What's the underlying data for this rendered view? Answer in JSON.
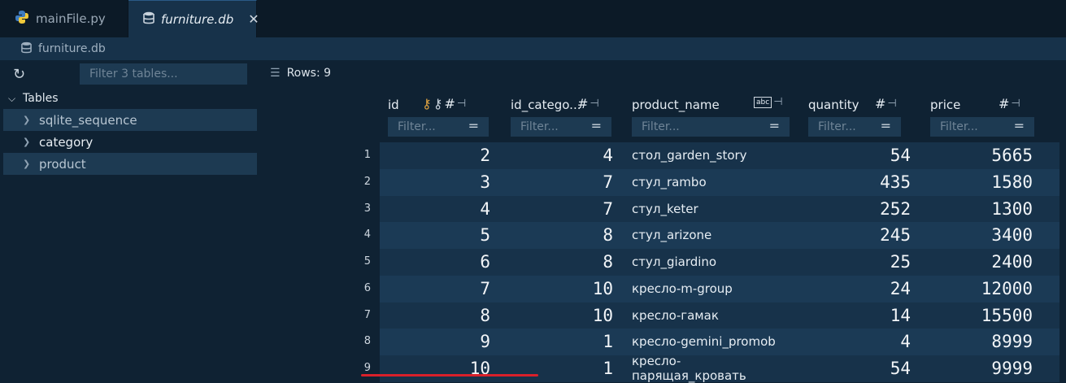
{
  "tabs": [
    {
      "label": "mainFile.py",
      "icon": "python-icon",
      "active": false
    },
    {
      "label": "furniture.db",
      "icon": "database-icon",
      "active": true,
      "close": "✕"
    }
  ],
  "breadcrumb": {
    "label": "furniture.db"
  },
  "sidebar": {
    "filter_placeholder": "Filter 3 tables...",
    "tree_root": "Tables",
    "items": [
      {
        "label": "sqlite_sequence"
      },
      {
        "label": "category"
      },
      {
        "label": "product"
      }
    ]
  },
  "main": {
    "rows_label": "Rows: 9",
    "columns": [
      {
        "name": "id",
        "filter_placeholder": "Filter..."
      },
      {
        "name": "id_catego...",
        "filter_placeholder": "Filter..."
      },
      {
        "name": "product_name",
        "filter_placeholder": "Filter..."
      },
      {
        "name": "quantity",
        "filter_placeholder": "Filter..."
      },
      {
        "name": "price",
        "filter_placeholder": "Filter..."
      }
    ],
    "rows": [
      {
        "n": "1",
        "id": "2",
        "cat": "4",
        "name": "стол_garden_story",
        "qty": "54",
        "price": "5665"
      },
      {
        "n": "2",
        "id": "3",
        "cat": "7",
        "name": "стул_rambo",
        "qty": "435",
        "price": "1580"
      },
      {
        "n": "3",
        "id": "4",
        "cat": "7",
        "name": "стул_keter",
        "qty": "252",
        "price": "1300"
      },
      {
        "n": "4",
        "id": "5",
        "cat": "8",
        "name": "стул_arizone",
        "qty": "245",
        "price": "3400"
      },
      {
        "n": "5",
        "id": "6",
        "cat": "8",
        "name": "стул_giardino",
        "qty": "25",
        "price": "2400"
      },
      {
        "n": "6",
        "id": "7",
        "cat": "10",
        "name": "кресло-m-group",
        "qty": "24",
        "price": "12000"
      },
      {
        "n": "7",
        "id": "8",
        "cat": "10",
        "name": "кресло-гамак",
        "qty": "14",
        "price": "15500"
      },
      {
        "n": "8",
        "id": "9",
        "cat": "1",
        "name": "кресло-gemini_promob",
        "qty": "4",
        "price": "8999"
      },
      {
        "n": "9",
        "id": "10",
        "cat": "1",
        "name": "кресло-парящая_кровать",
        "qty": "54",
        "price": "9999"
      }
    ]
  },
  "colors": {
    "accent_key": "#e0a340",
    "annotation_underline": "#d9202a"
  }
}
